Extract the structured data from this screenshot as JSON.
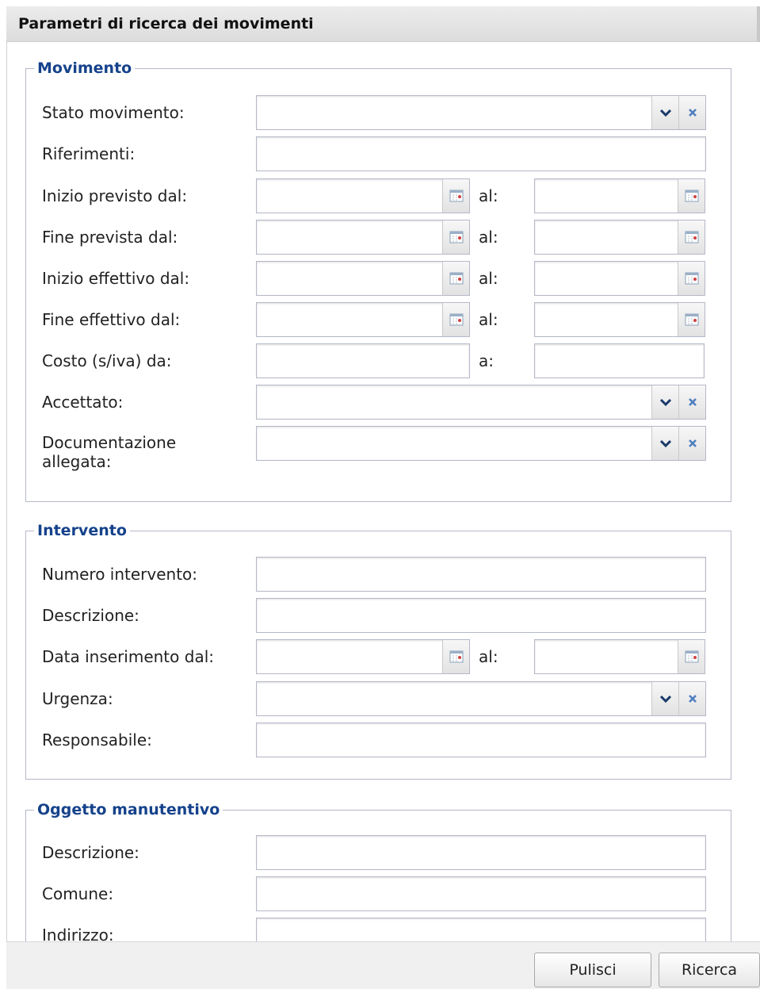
{
  "panel": {
    "title": "Parametri di ricerca dei movimenti"
  },
  "movimento": {
    "legend": "Movimento",
    "stato_label": "Stato movimento:",
    "riferimenti_label": "Riferimenti:",
    "inizio_previsto_label": "Inizio previsto dal:",
    "fine_prevista_label": "Fine prevista dal:",
    "inizio_effettivo_label": "Inizio effettivo dal:",
    "fine_effettivo_label": "Fine effettivo dal:",
    "costo_label": "Costo (s/iva) da:",
    "accettato_label": "Accettato:",
    "documentazione_label": "Documentazione allegata:",
    "al_label": "al:",
    "a_label": "a:"
  },
  "intervento": {
    "legend": "Intervento",
    "numero_label": "Numero intervento:",
    "descrizione_label": "Descrizione:",
    "data_inserimento_label": "Data inserimento dal:",
    "urgenza_label": "Urgenza:",
    "responsabile_label": "Responsabile:",
    "al_label": "al:"
  },
  "oggetto": {
    "legend": "Oggetto manutentivo",
    "descrizione_label": "Descrizione:",
    "comune_label": "Comune:",
    "indirizzo_label": "Indirizzo:"
  },
  "buttons": {
    "pulisci": "Pulisci",
    "ricerca": "Ricerca"
  },
  "colors": {
    "legend": "#15428b",
    "border": "#b5b8c8",
    "clear_icon": "#4f7fbf"
  }
}
